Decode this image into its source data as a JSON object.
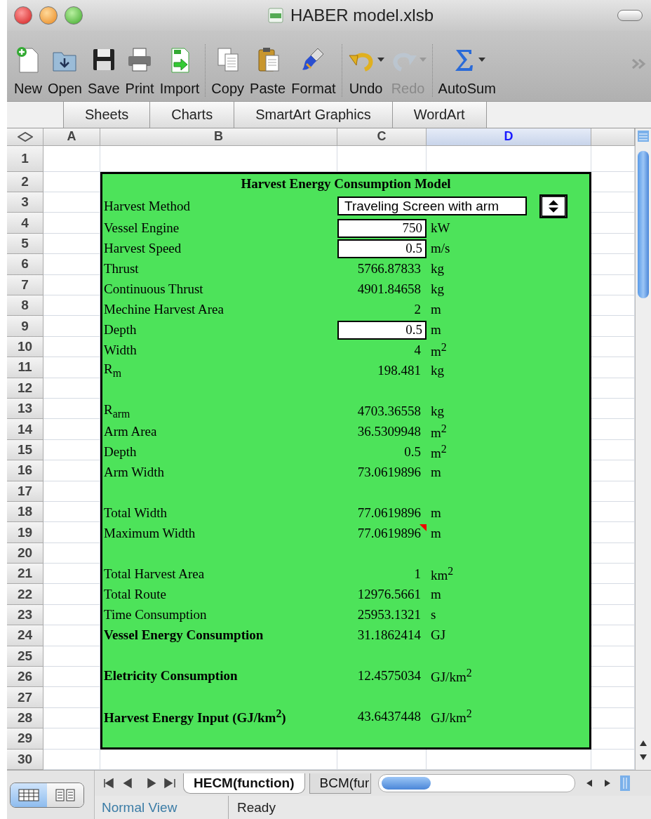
{
  "window": {
    "title": "HABER model.xlsb"
  },
  "toolbar": {
    "groups": [
      [
        {
          "label": "New",
          "menu": false,
          "disabled": false
        },
        {
          "label": "Open",
          "menu": false,
          "disabled": false
        },
        {
          "label": "Save",
          "menu": false,
          "disabled": false
        },
        {
          "label": "Print",
          "menu": false,
          "disabled": false
        },
        {
          "label": "Import",
          "menu": false,
          "disabled": false
        }
      ],
      [
        {
          "label": "Copy",
          "menu": false,
          "disabled": false
        },
        {
          "label": "Paste",
          "menu": false,
          "disabled": false
        },
        {
          "label": "Format",
          "menu": false,
          "disabled": false
        }
      ],
      [
        {
          "label": "Undo",
          "menu": true,
          "disabled": false
        },
        {
          "label": "Redo",
          "menu": true,
          "disabled": true
        }
      ],
      [
        {
          "label": "AutoSum",
          "menu": true,
          "disabled": false
        }
      ]
    ]
  },
  "ribbon_tabs": [
    "Sheets",
    "Charts",
    "SmartArt Graphics",
    "WordArt"
  ],
  "columns": [
    {
      "label": "A",
      "selected": false
    },
    {
      "label": "B",
      "selected": false
    },
    {
      "label": "C",
      "selected": false
    },
    {
      "label": "D",
      "selected": true
    }
  ],
  "row_numbers": [
    "1",
    "2",
    "3",
    "4",
    "5",
    "6",
    "7",
    "8",
    "9",
    "10",
    "11",
    "12",
    "13",
    "14",
    "15",
    "16",
    "17",
    "18",
    "19",
    "20",
    "21",
    "22",
    "23",
    "24",
    "25",
    "26",
    "27",
    "28",
    "29",
    "30"
  ],
  "model": {
    "title": "Harvest Energy Consumption Model",
    "rows": [
      {
        "kind": "dropdown",
        "label": "Harvest Method",
        "value": "Traveling Screen with arm"
      },
      {
        "kind": "input",
        "label": "Vessel Engine",
        "value": "750",
        "unit": "kW"
      },
      {
        "kind": "input",
        "label": "Harvest Speed",
        "value": "0.5",
        "unit": "m/s"
      },
      {
        "kind": "value",
        "label": "Thrust",
        "value": "5766.87833",
        "unit": "kg"
      },
      {
        "kind": "value",
        "label": "Continuous Thrust",
        "value": "4901.84658",
        "unit": "kg"
      },
      {
        "kind": "value",
        "label": "Mechine Harvest Area",
        "value": "2",
        "unit": "m"
      },
      {
        "kind": "input",
        "label": "Depth",
        "value": "0.5",
        "unit": "m"
      },
      {
        "kind": "value",
        "label": "Width",
        "value": "4",
        "unit": "m$^{2}$"
      },
      {
        "kind": "value",
        "label": "R$_{m}$",
        "value": "198.481",
        "unit": "kg"
      },
      {
        "kind": "blank"
      },
      {
        "kind": "value",
        "label": "R$_{arm}$",
        "value": "4703.36558",
        "unit": "kg"
      },
      {
        "kind": "value",
        "label": "Arm Area",
        "value": "36.5309948",
        "unit": "m$^{2}$"
      },
      {
        "kind": "value",
        "label": "Depth",
        "value": "0.5",
        "unit": "m$^{2}$"
      },
      {
        "kind": "value",
        "label": "Arm Width",
        "value": "73.0619896",
        "unit": "m"
      },
      {
        "kind": "blank"
      },
      {
        "kind": "value",
        "label": "Total Width",
        "value": "77.0619896",
        "unit": "m"
      },
      {
        "kind": "value",
        "label": "Maximum Width",
        "value": "77.0619896",
        "unit": "m",
        "comment": true
      },
      {
        "kind": "blank"
      },
      {
        "kind": "value",
        "label": "Total Harvest Area",
        "value": "1",
        "unit": "km$^{2}$"
      },
      {
        "kind": "value",
        "label": "Total Route",
        "value": "12976.5661",
        "unit": "m"
      },
      {
        "kind": "value",
        "label": "Time Consumption",
        "value": "25953.1321",
        "unit": "s"
      },
      {
        "kind": "value",
        "label": "Vessel Energy Consumption",
        "value": "31.1862414",
        "unit": "GJ",
        "bold": true
      },
      {
        "kind": "blank"
      },
      {
        "kind": "value",
        "label": "Eletricity Consumption",
        "value": "12.4575034",
        "unit": "GJ/km$^{2}$",
        "bold": true
      },
      {
        "kind": "blank"
      },
      {
        "kind": "value",
        "label": "Harvest Energy Input (GJ/km$^{2}$)",
        "value": "43.6437448",
        "unit": "GJ/km$^{2}$",
        "bold": true
      },
      {
        "kind": "blank"
      }
    ]
  },
  "sheet_tabs": [
    {
      "label": "HECM(function)",
      "selected": true
    },
    {
      "label": "BCM(fur",
      "selected": false
    }
  ],
  "view_buttons": [
    {
      "selected": true
    },
    {
      "selected": false
    }
  ],
  "status_bar": {
    "view": "Normal View",
    "status": "Ready"
  }
}
